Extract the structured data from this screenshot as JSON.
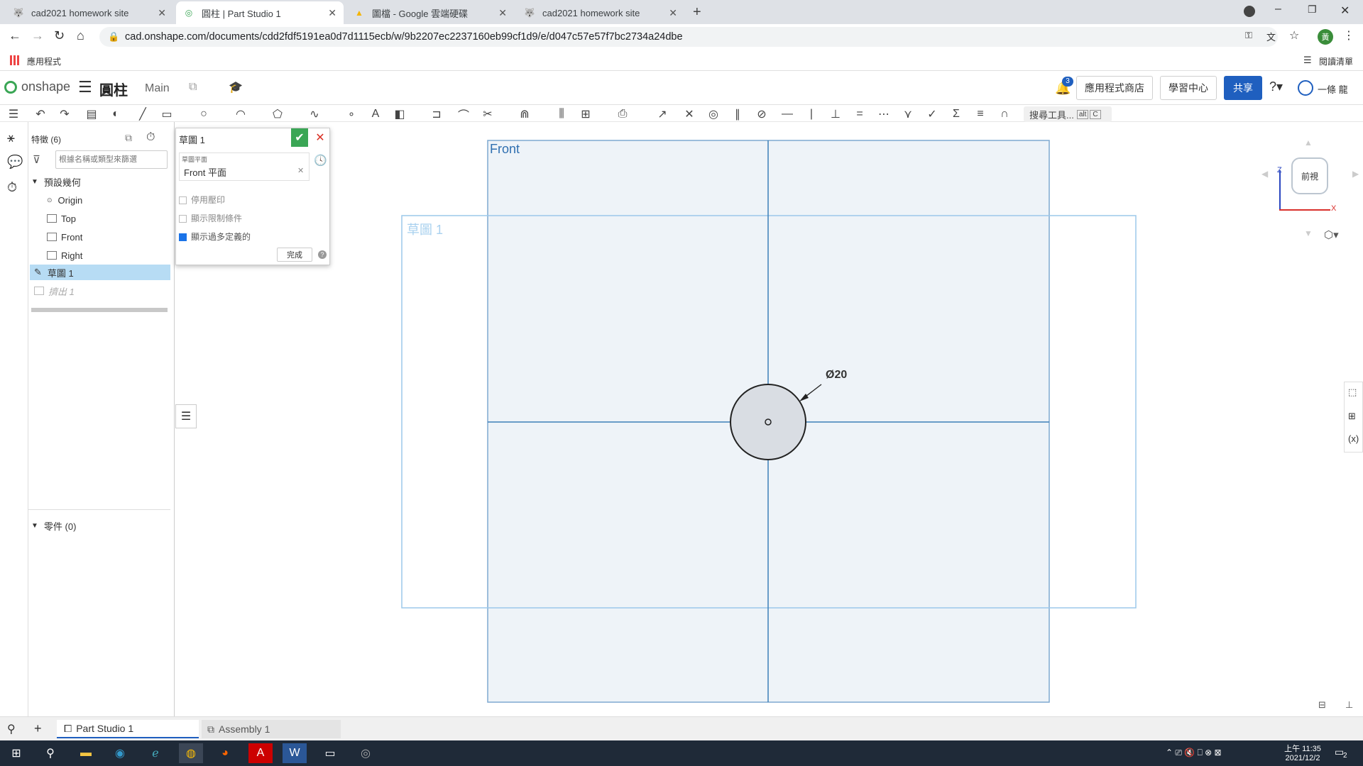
{
  "browser": {
    "tabs": [
      {
        "title": "cad2021 homework site",
        "icon": "wolf-icon"
      },
      {
        "title": "圓柱 | Part Studio 1",
        "icon": "onshape-icon"
      },
      {
        "title": "圖檔 - Google 雲端硬碟",
        "icon": "drive-icon"
      },
      {
        "title": "cad2021 homework site",
        "icon": "wolf-icon"
      }
    ],
    "url": "cad.onshape.com/documents/cdd2fdf5191ea0d7d1115ecb/w/9b2207ec2237160eb99cf1d9/e/d047c57e57f7bc2734a24dbe",
    "bookmarks_apps": "應用程式",
    "reading_list": "閱讀清單",
    "profile_initial": "黃"
  },
  "app": {
    "logo": "onshape",
    "document_title": "圓柱",
    "branch": "Main",
    "notif_count": "3",
    "app_store": "應用程式商店",
    "learning_center": "學習中心",
    "share": "共享",
    "user": "一條 龍",
    "search_tools": "搜尋工具...",
    "search_shortcut_1": "alt",
    "search_shortcut_2": "C",
    "accent": "#1f5fbf"
  },
  "features": {
    "header": "特徵 (6)",
    "filter_placeholder": "根據名稱或類型來篩選",
    "default_geometry": "預設幾何",
    "items": [
      "Origin",
      "Top",
      "Front",
      "Right"
    ],
    "sketch": "草圖 1",
    "extrude": "擠出 1",
    "parts": "零件 (0)"
  },
  "sketch_dialog": {
    "title": "草圖 1",
    "plane_label": "草圖平面",
    "plane_value": "Front 平面",
    "opt1": "停用壓印",
    "opt2": "顯示限制條件",
    "opt3": "顯示過多定義的",
    "finish": "完成"
  },
  "viewport": {
    "plane_label": "Front",
    "sketch_label": "草圖 1",
    "dimension": "Ø20",
    "view_cube_label": "前視",
    "axis_z": "Z",
    "axis_x": "X"
  },
  "bottom_tabs": [
    "Part Studio 1",
    "Assembly 1"
  ],
  "taskbar": {
    "time": "上午 11:35",
    "date": "2021/12/2",
    "notif": "2"
  }
}
